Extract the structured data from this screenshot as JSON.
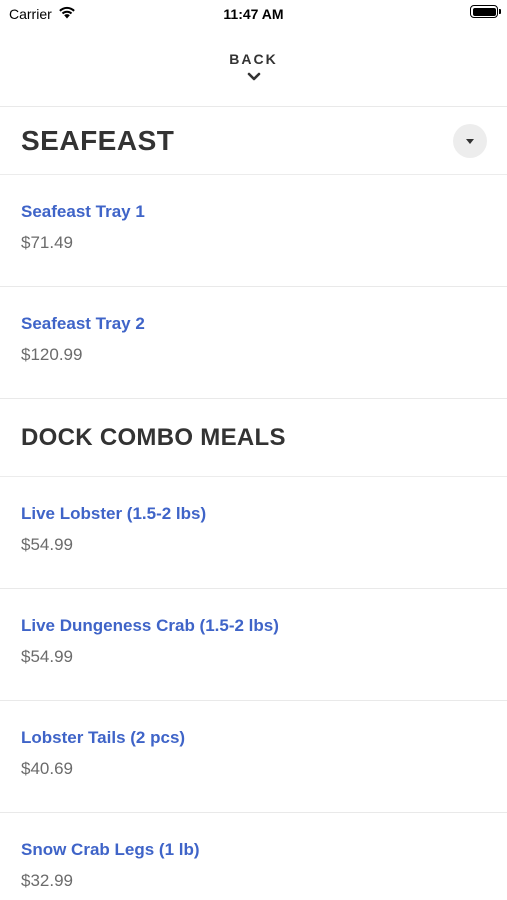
{
  "status": {
    "carrier": "Carrier",
    "time": "11:47 AM"
  },
  "nav": {
    "back_label": "BACK"
  },
  "sections": [
    {
      "title": "SEAFEAST",
      "items": [
        {
          "name": "Seafeast Tray 1",
          "price": "$71.49"
        },
        {
          "name": "Seafeast Tray 2",
          "price": "$120.99"
        }
      ]
    },
    {
      "title": "DOCK COMBO MEALS",
      "items": [
        {
          "name": "Live Lobster (1.5-2 lbs)",
          "price": "$54.99"
        },
        {
          "name": "Live Dungeness Crab (1.5-2 lbs)",
          "price": "$54.99"
        },
        {
          "name": "Lobster Tails (2 pcs)",
          "price": "$40.69"
        },
        {
          "name": "Snow Crab Legs (1 lb)",
          "price": "$32.99"
        }
      ]
    }
  ],
  "colors": {
    "link": "#3f64c8",
    "price": "#6b6b6b",
    "heading": "#333333"
  },
  "icons": {
    "wifi": "wifi-icon",
    "battery": "battery-icon",
    "back": "chevron-down-icon",
    "dropdown": "caret-down-icon"
  }
}
